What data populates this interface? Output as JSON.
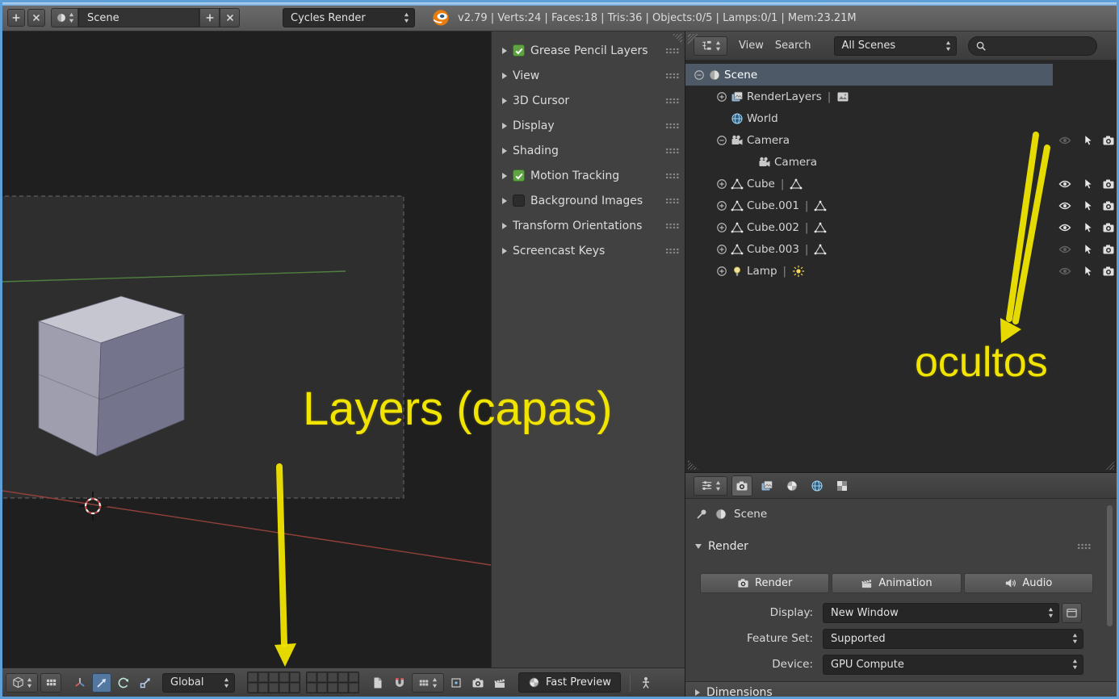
{
  "info_bar": {
    "scene_field": "Scene",
    "engine": "Cycles Render",
    "stats": "v2.79 | Verts:24 | Faces:18 | Tris:36 | Objects:0/5 | Lamps:0/1 | Mem:23.21M"
  },
  "npanel": {
    "items": [
      {
        "label": "Grease Pencil Layers",
        "checkbox": "checked"
      },
      {
        "label": "View"
      },
      {
        "label": "3D Cursor"
      },
      {
        "label": "Display"
      },
      {
        "label": "Shading"
      },
      {
        "label": "Motion Tracking",
        "checkbox": "checked"
      },
      {
        "label": "Background Images",
        "checkbox": "unchecked"
      },
      {
        "label": "Transform Orientations"
      },
      {
        "label": "Screencast Keys"
      }
    ]
  },
  "outliner": {
    "view_menu": "View",
    "search_menu": "Search",
    "scene_filter": "All Scenes",
    "search_value": "",
    "rows": [
      {
        "label": "Scene",
        "selected": true
      },
      {
        "label": "RenderLayers"
      },
      {
        "label": "World"
      },
      {
        "label": "Camera",
        "hidden": true
      },
      {
        "label": "Camera"
      },
      {
        "label": "Cube",
        "hidden": false
      },
      {
        "label": "Cube.001",
        "hidden": false
      },
      {
        "label": "Cube.002",
        "hidden": false
      },
      {
        "label": "Cube.003",
        "hidden": true
      },
      {
        "label": "Lamp",
        "hidden": true
      }
    ]
  },
  "properties": {
    "context": "Scene",
    "render_panel": {
      "title": "Render",
      "render_btn": "Render",
      "animation_btn": "Animation",
      "audio_btn": "Audio",
      "display_label": "Display:",
      "display_value": "New Window",
      "feature_label": "Feature Set:",
      "feature_value": "Supported",
      "device_label": "Device:",
      "device_value": "GPU Compute"
    },
    "dimensions_panel": "Dimensions"
  },
  "view3d_header": {
    "orientation": "Global",
    "fast_preview": "Fast Preview"
  },
  "annotations": {
    "layers": "Layers (capas)",
    "hidden": "ocultos"
  },
  "icons": {
    "search": "magnifier-icon",
    "hide": "eye-icon",
    "selectable": "mouse-cursor-icon",
    "renderable": "camera-icon",
    "snap": "magnet-icon",
    "logo": "blender-logo"
  },
  "colors": {
    "window_accent": "#5f9fd8",
    "annotation_yellow": "#f0e400",
    "selected_row": "#4d5967",
    "checkbox_green": "#5fa344"
  }
}
